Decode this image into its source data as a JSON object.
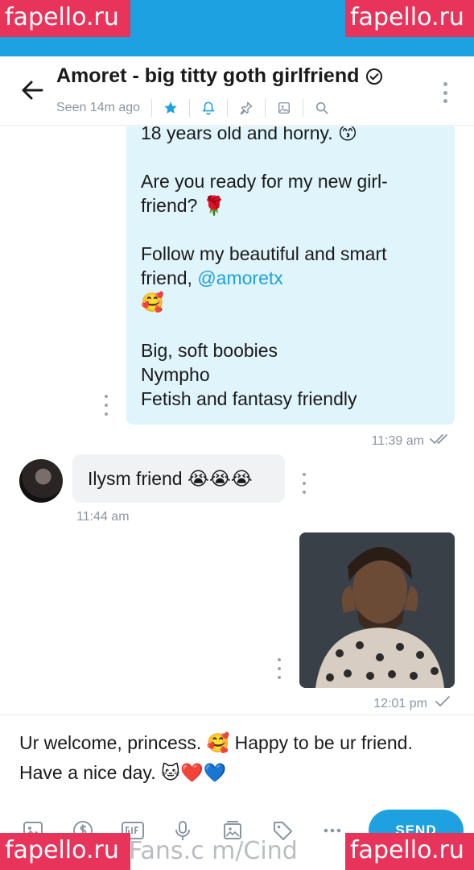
{
  "watermark": {
    "text": "fapello.ru",
    "center_text": "Fans.c m/Cind"
  },
  "header": {
    "title": "Amoret - big titty goth girlfriend",
    "seen": "Seen 14m ago",
    "icons": [
      "back-arrow-icon",
      "verified-icon",
      "star-icon",
      "bell-icon",
      "pin-icon",
      "media-icon",
      "search-icon",
      "more-vertical-icon"
    ]
  },
  "messages": {
    "outgoing": {
      "line1": "18 years old and horny. 😙",
      "line2": "Are you ready for my new girl-",
      "line3": "friend? 🌹",
      "line4": "Follow my beautiful and smart",
      "line5_prefix": "friend, ",
      "line5_link": "@amoretx",
      "line6": "🥰",
      "line7": "Big, soft boobies",
      "line8": "Nympho",
      "line9": "Fetish and fantasy friendly",
      "time": "11:39 am"
    },
    "incoming": {
      "text": "Ilysm friend 😭😭😭",
      "time": "11:44 am"
    },
    "photo": {
      "time": "12:01 pm"
    }
  },
  "composer": {
    "line1": "Ur welcome, princess. 🥰 Happy to be ur friend.",
    "line2": "Have a nice day. 🐱❤️💙",
    "send_label": "SEND",
    "tools": [
      "image-icon",
      "dollar-icon",
      "gif-icon",
      "microphone-icon",
      "vault-icon",
      "price-tag-icon",
      "more-horizontal-icon"
    ]
  },
  "colors": {
    "accent": "#1da1e0",
    "bubble_out": "#dff4fb",
    "bubble_in": "#f0f2f4",
    "watermark": "#e8345a"
  }
}
